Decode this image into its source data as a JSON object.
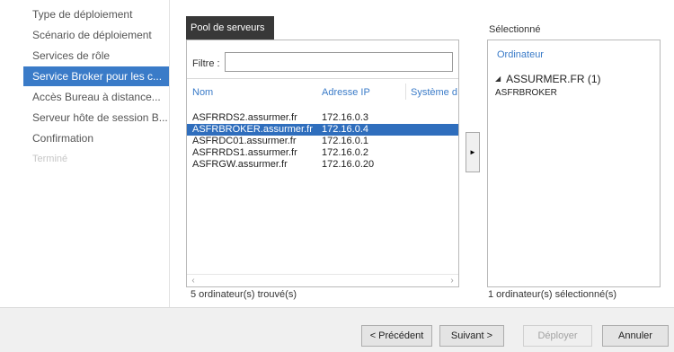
{
  "nav": {
    "items": [
      {
        "label": "Type de déploiement",
        "state": "normal"
      },
      {
        "label": "Scénario de déploiement",
        "state": "normal"
      },
      {
        "label": "Services de rôle",
        "state": "normal"
      },
      {
        "label": "Service Broker pour les c...",
        "state": "active"
      },
      {
        "label": "Accès Bureau à distance...",
        "state": "normal"
      },
      {
        "label": "Serveur hôte de session B...",
        "state": "normal"
      },
      {
        "label": "Confirmation",
        "state": "normal"
      },
      {
        "label": "Terminé",
        "state": "disabled"
      }
    ]
  },
  "pool": {
    "tab_label": "Pool de serveurs",
    "filter_label": "Filtre :",
    "filter_value": "",
    "columns": {
      "name": "Nom",
      "ip": "Adresse IP",
      "os": "Système d"
    },
    "rows": [
      {
        "name": "ASFRRDS2.assurmer.fr",
        "ip": "172.16.0.3",
        "selected": false
      },
      {
        "name": "ASFRBROKER.assurmer.fr",
        "ip": "172.16.0.4",
        "selected": true
      },
      {
        "name": "ASFRDC01.assurmer.fr",
        "ip": "172.16.0.1",
        "selected": false
      },
      {
        "name": "ASFRRDS1.assurmer.fr",
        "ip": "172.16.0.2",
        "selected": false
      },
      {
        "name": "ASFRGW.assurmer.fr",
        "ip": "172.16.0.20",
        "selected": false
      }
    ],
    "count_text": "5 ordinateur(s) trouvé(s)"
  },
  "move_button": {
    "glyph": "►"
  },
  "selected": {
    "label": "Sélectionné",
    "column": "Ordinateur",
    "group": "ASSURMER.FR (1)",
    "servers": [
      "ASFRBROKER"
    ],
    "count_text": "1 ordinateur(s) sélectionné(s)"
  },
  "buttons": {
    "previous": "< Précédent",
    "next": "Suivant >",
    "deploy": "Déployer",
    "cancel": "Annuler"
  },
  "colors": {
    "accent": "#3a7bc8",
    "selection": "#2f6ebd",
    "tab_header": "#383838"
  }
}
